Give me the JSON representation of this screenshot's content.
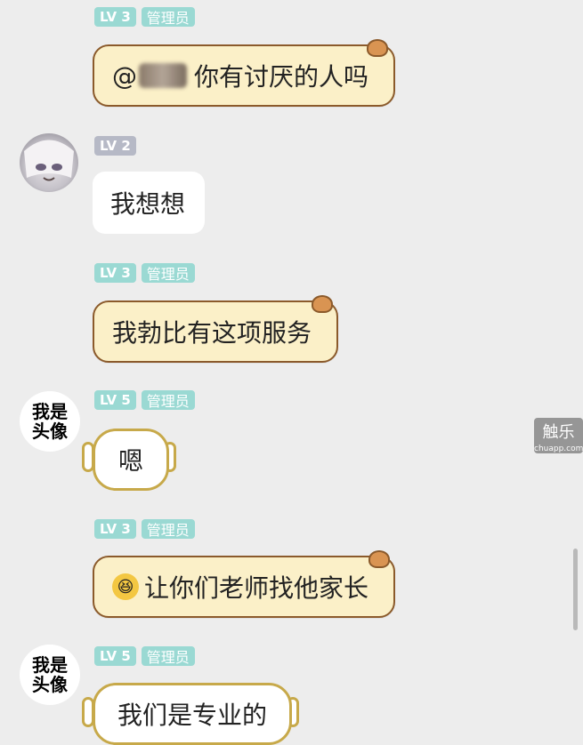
{
  "messages": [
    {
      "level": "LV 3",
      "role": "管理员",
      "text_prefix": "@",
      "text": "你有讨厌的人吗"
    },
    {
      "level": "LV 2",
      "text": "我想想"
    },
    {
      "level": "LV 3",
      "role": "管理员",
      "text": "我勃比有这项服务"
    },
    {
      "level": "LV 5",
      "role": "管理员",
      "avatar_text_1": "我是",
      "avatar_text_2": "头像",
      "text": "嗯"
    },
    {
      "level": "LV 3",
      "role": "管理员",
      "text": "让你们老师找他家长"
    },
    {
      "level": "LV 5",
      "role": "管理员",
      "avatar_text_1": "我是",
      "avatar_text_2": "头像",
      "text": "我们是专业的"
    }
  ],
  "watermark": {
    "text": "触乐",
    "sub": "chuapp.com"
  }
}
